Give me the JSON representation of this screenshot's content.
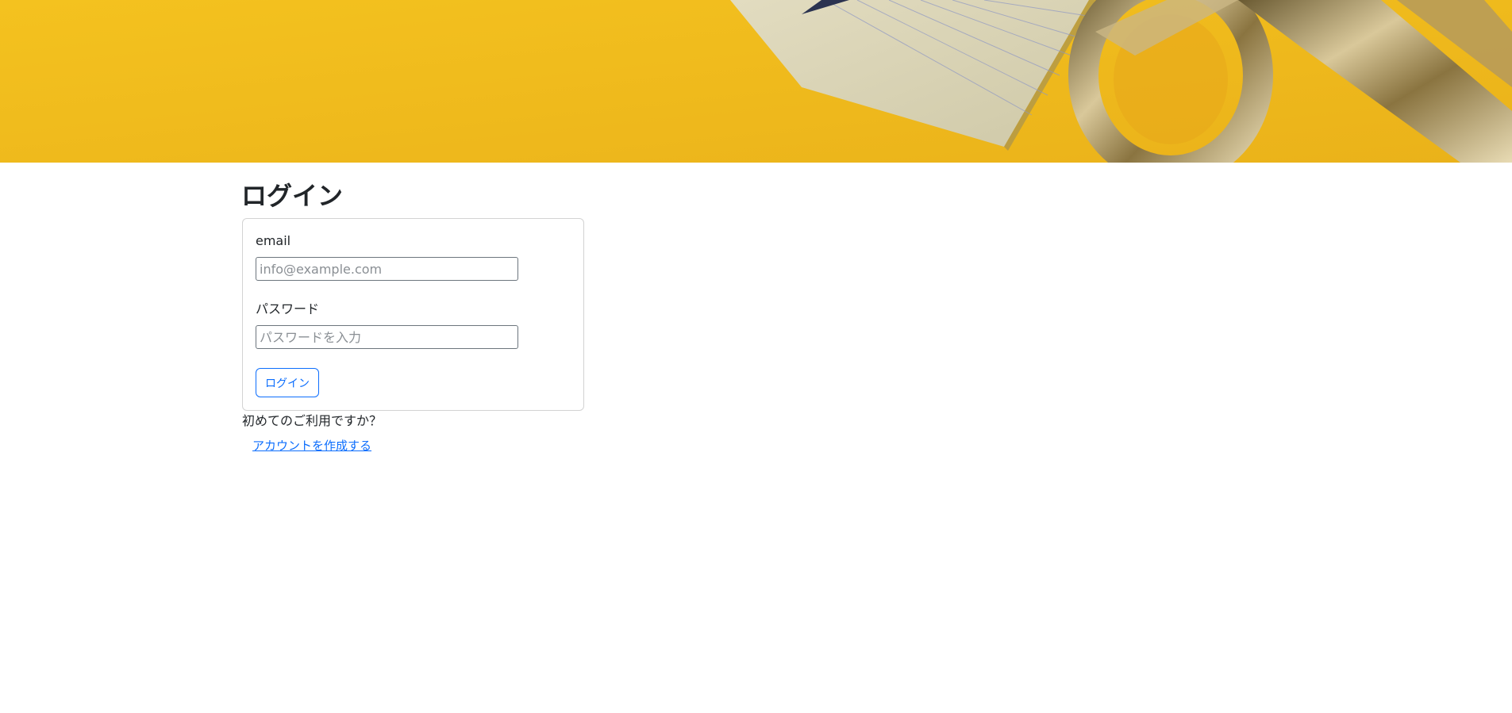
{
  "page": {
    "title": "ログイン"
  },
  "hero": {
    "image": "yellow-desk-notepad-scissors-photo",
    "background_color": "#f2bc1f"
  },
  "login_form": {
    "email_label": "email",
    "email_placeholder": "info@example.com",
    "email_value": "",
    "password_label": "パスワード",
    "password_placeholder": "パスワードを入力",
    "password_value": "",
    "submit_label": "ログイン"
  },
  "signup": {
    "prompt": "初めてのご利用ですか？",
    "link_label": "アカウントを作成する"
  },
  "colors": {
    "accent": "#0d6efd",
    "text": "#212529",
    "border": "#d3d3d3"
  }
}
